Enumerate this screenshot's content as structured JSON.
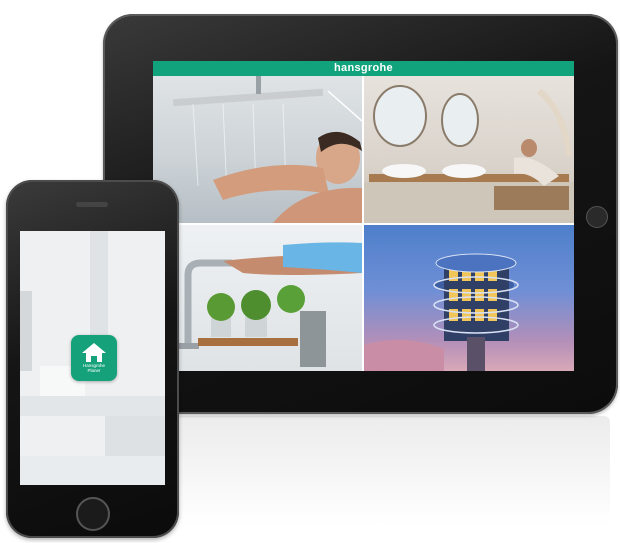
{
  "tablet": {
    "brand_bar_text": "hansgrohe",
    "tiles": [
      {
        "name": "shower-photo"
      },
      {
        "name": "bathroom-photo"
      },
      {
        "name": "kitchen-faucet-photo"
      },
      {
        "name": "tower-building-photo"
      }
    ]
  },
  "phone": {
    "app_icon": {
      "icon": "home-icon",
      "label_line1": "Hansgrohe",
      "label_line2": "Planer",
      "color": "#15a27a"
    }
  },
  "colors": {
    "brand_green": "#11a37c",
    "device_body": "#151515"
  }
}
